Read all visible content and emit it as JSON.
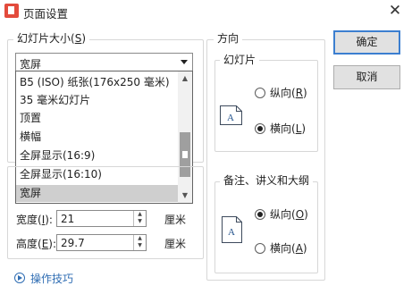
{
  "window": {
    "title": "页面设置",
    "icons": {
      "app": "wps-presentation-app-icon",
      "close": "close-x-icon"
    }
  },
  "slide_size": {
    "group_label": "幻灯片大小",
    "hotkey": "S",
    "selected_value": "宽屏",
    "dropdown_options": [
      "B5 (ISO) 纸张(176x250 毫米)",
      "35 毫米幻灯片",
      "顶置",
      "横幅",
      "全屏显示(16:9)",
      "全屏显示(16:10)",
      "宽屏"
    ],
    "highlighted_option": "宽屏",
    "scroll_fraction": 0.9
  },
  "dimensions": {
    "width": {
      "label": "宽度",
      "hotkey": "I",
      "value": "21",
      "unit": "厘米"
    },
    "height": {
      "label": "高度",
      "hotkey": "E",
      "value": "29.7",
      "unit": "厘米"
    }
  },
  "orientation": {
    "group_label": "方向",
    "slides": {
      "group_label": "幻灯片",
      "page_letter": "A",
      "options": [
        {
          "label": "纵向",
          "hotkey": "R",
          "selected": false
        },
        {
          "label": "横向",
          "hotkey": "L",
          "selected": true
        }
      ]
    },
    "notes": {
      "group_label": "备注、讲义和大纲",
      "page_letter": "A",
      "options": [
        {
          "label": "纵向",
          "hotkey": "O",
          "selected": true
        },
        {
          "label": "横向",
          "hotkey": "A",
          "selected": false
        }
      ]
    }
  },
  "buttons": {
    "ok": "确定",
    "cancel": "取消"
  },
  "footer": {
    "tips_link": "操作技巧"
  },
  "colors": {
    "accent": "#3c7fd0",
    "link": "#2f6db3",
    "selection": "#cfcfcf"
  }
}
